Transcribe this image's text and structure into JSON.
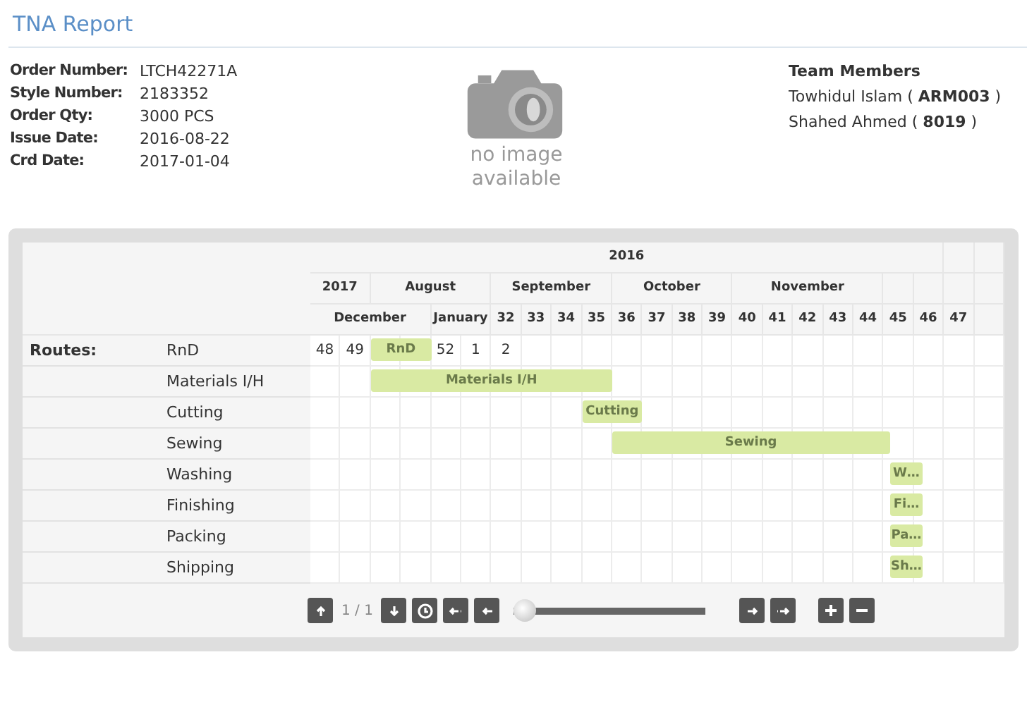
{
  "title": "TNA Report",
  "order_info": [
    {
      "label": "Order Number:",
      "value": "LTCH42271A"
    },
    {
      "label": "Style Number:",
      "value": "2183352"
    },
    {
      "label": "Order Qty:",
      "value": "3000 PCS"
    },
    {
      "label": "Issue Date:",
      "value": "2016-08-22"
    },
    {
      "label": "Crd Date:",
      "value": "2017-01-04"
    }
  ],
  "image_placeholder": {
    "text": "no image available"
  },
  "team": {
    "heading": "Team Members",
    "members": [
      {
        "name": "Towhidul Islam ( **ARM003** )"
      },
      {
        "name": "Shahed Ahmed ( **8019** )"
      }
    ]
  },
  "gantt": {
    "header_rows": [
      [
        "2016"
      ],
      [
        "2017",
        "August",
        "September",
        "October",
        "November"
      ],
      [
        "December",
        "January",
        "32",
        "33",
        "34",
        "35",
        "36",
        "37",
        "38",
        "39",
        "40",
        "41",
        "42",
        "43",
        "44",
        "45",
        "46",
        "47"
      ]
    ],
    "routes_label": "Routes:",
    "routes": [
      {
        "name": "RnD",
        "cells": [
          "48",
          "49",
          "52",
          "1",
          "2"
        ],
        "bar": "RnD"
      },
      {
        "name": "Materials I/H",
        "bar": "Materials I/H"
      },
      {
        "name": "Cutting",
        "bar": "Cutting"
      },
      {
        "name": "Sewing",
        "bar": "Sewing"
      },
      {
        "name": "Washing",
        "bar": "W…"
      },
      {
        "name": "Finishing",
        "bar": "Fi…"
      },
      {
        "name": "Packing",
        "bar": "Pa…"
      },
      {
        "name": "Shipping",
        "bar": "Sh…"
      }
    ]
  },
  "controls": {
    "page": "1 / 1",
    "zoom_slider": {
      "level": 0
    }
  }
}
